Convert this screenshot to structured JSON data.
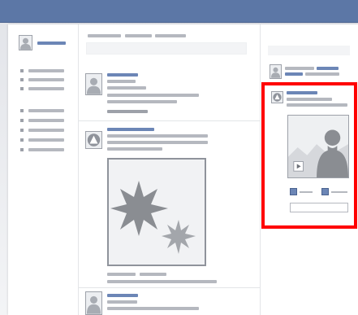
{
  "colors": {
    "top_bar": "#5c77a6",
    "link_blue": "#6c86b6",
    "placeholder_gray": "#b5b8bf",
    "highlight_red": "#ff0000",
    "page_background": "#ffffff"
  },
  "icons": {
    "profile_avatar": "person-silhouette-icon",
    "page_avatar": "triangle-in-circle-icon",
    "feed_image": "starburst-shapes-icon",
    "video_play": "play-icon",
    "like": "thumbs-up-icon",
    "share": "share-icon"
  },
  "wireframe": {
    "description_text": "",
    "highlighted_region": "right-sidebar-video-ad"
  }
}
